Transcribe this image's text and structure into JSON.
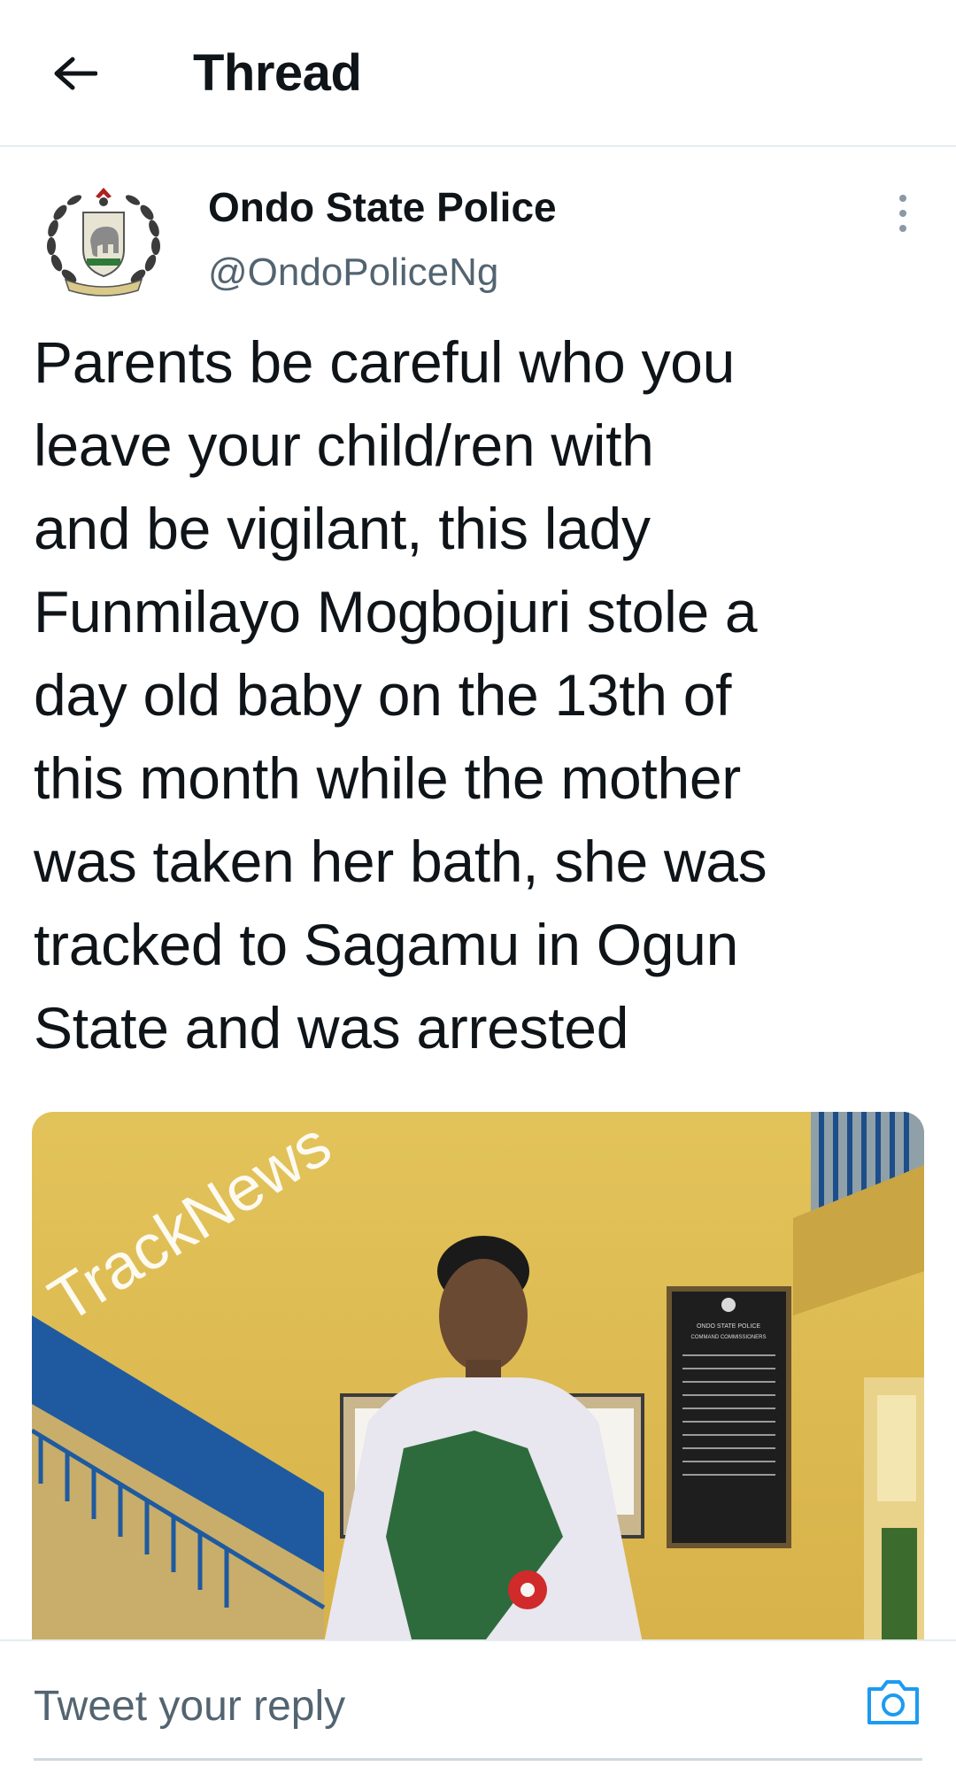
{
  "header": {
    "title": "Thread",
    "back_icon": "arrow-left-icon"
  },
  "tweet": {
    "author_name": "Ondo State Police",
    "author_handle": "@OndoPoliceNg",
    "avatar_icon": "police-crest-logo",
    "text": "Parents be careful who you\nleave your child/ren with\nand be vigilant, this lady\nFunmilayo Mogbojuri  stole a\nday old baby on the 13th of\nthis month while the mother\nwas taken her bath, she was\ntracked to Sagamu in Ogun\nState and was arrested",
    "media": {
      "watermark": "TrackNews",
      "plaque_title": "ONDO STATE POLICE",
      "plaque_subtitle": "COMMAND COMMISSIONERS"
    }
  },
  "reply": {
    "placeholder": "Tweet your reply",
    "camera_icon": "camera-icon"
  },
  "colors": {
    "accent": "#1d9bf0",
    "secondary_text": "#536471",
    "divider": "#e6ecf0"
  }
}
